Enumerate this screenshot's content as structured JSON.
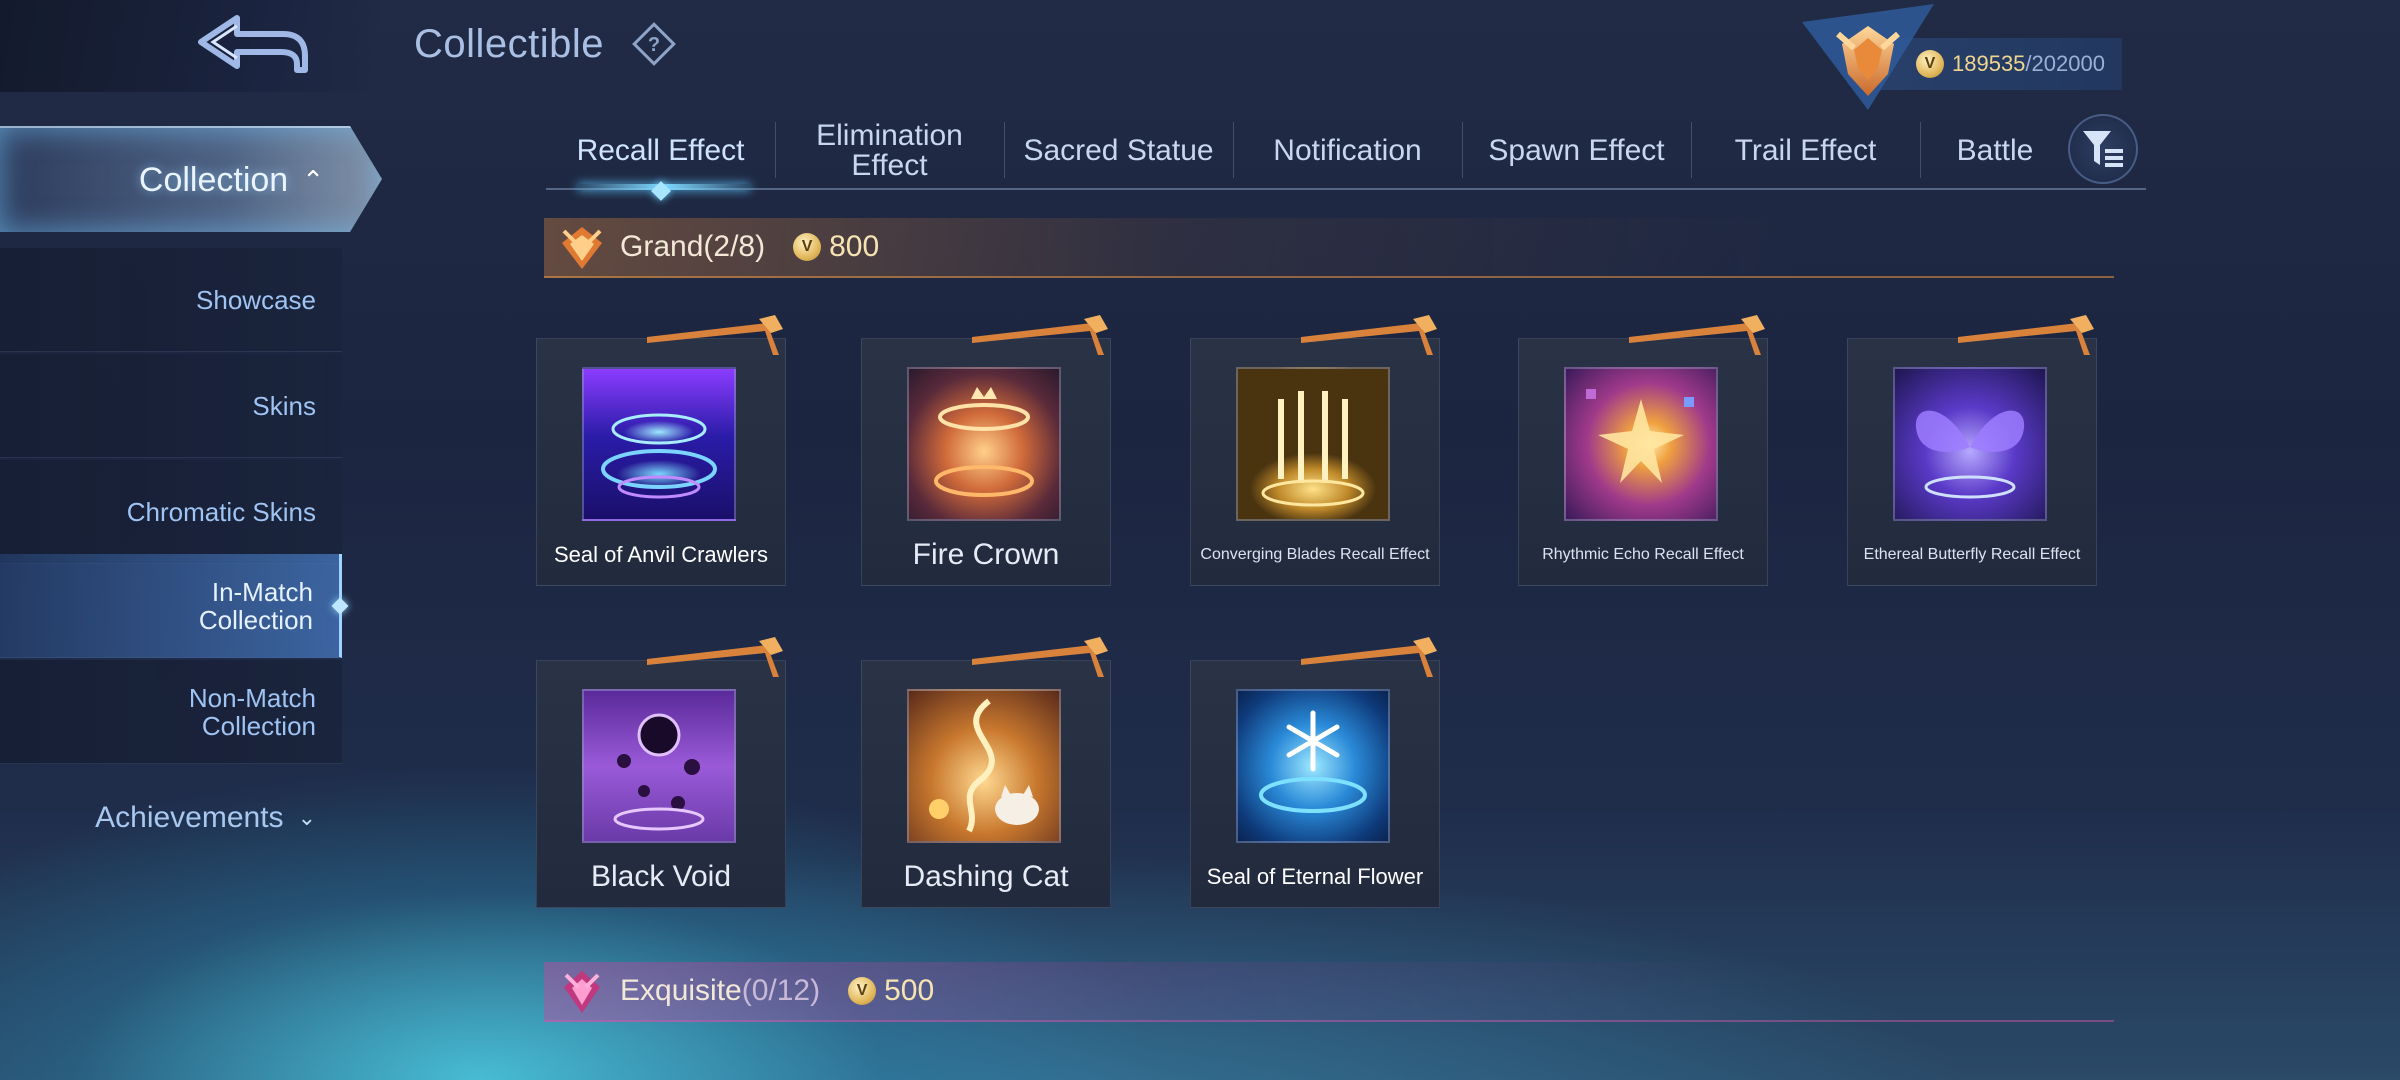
{
  "header": {
    "title": "Collectible",
    "points_current": "189535",
    "points_separator": "/",
    "points_total": "202000"
  },
  "sidebar": {
    "collection_label": "Collection",
    "items": [
      {
        "label": "Showcase"
      },
      {
        "label": "Skins"
      },
      {
        "label": "Chromatic Skins"
      },
      {
        "label": "In-Match Collection",
        "active": true
      },
      {
        "label": "Non-Match Collection"
      }
    ],
    "achievements_label": "Achievements"
  },
  "tabs": [
    {
      "label": "Recall Effect",
      "active": true
    },
    {
      "label": "Elimination Effect"
    },
    {
      "label": "Sacred Statue"
    },
    {
      "label": "Notification"
    },
    {
      "label": "Spawn Effect"
    },
    {
      "label": "Trail Effect"
    },
    {
      "label": "Battle"
    }
  ],
  "sections": {
    "grand": {
      "name": "Grand",
      "count": "(2/8)",
      "price": "800"
    },
    "exquisite": {
      "name": "Exquisite",
      "count": "(0/12)",
      "price": "500"
    }
  },
  "items": [
    {
      "name": "Seal of Anvil Crawlers",
      "theme": "blue-purple rings"
    },
    {
      "name": "Fire Crown",
      "theme": "golden fire ring"
    },
    {
      "name": "Converging Blades Recall Effect",
      "theme": "golden blades"
    },
    {
      "name": "Rhythmic Echo Recall Effect",
      "theme": "purple burst"
    },
    {
      "name": "Ethereal Butterfly Recall Effect",
      "theme": "violet butterfly"
    },
    {
      "name": "Black Void",
      "theme": "purple void"
    },
    {
      "name": "Dashing Cat",
      "theme": "golden cat"
    },
    {
      "name": "Seal of Eternal Flower",
      "theme": "blue snowflake"
    }
  ],
  "colors": {
    "accent": "#7fd8ff",
    "grand": "#e8954a",
    "exquisite": "#d0509e",
    "coin": "#e2b85c"
  },
  "icons": {
    "back": "back-arrow-icon",
    "help": "question-diamond-icon",
    "filter": "filter-icon",
    "coin": "coin-icon",
    "rank": "rank-emblem-icon"
  }
}
